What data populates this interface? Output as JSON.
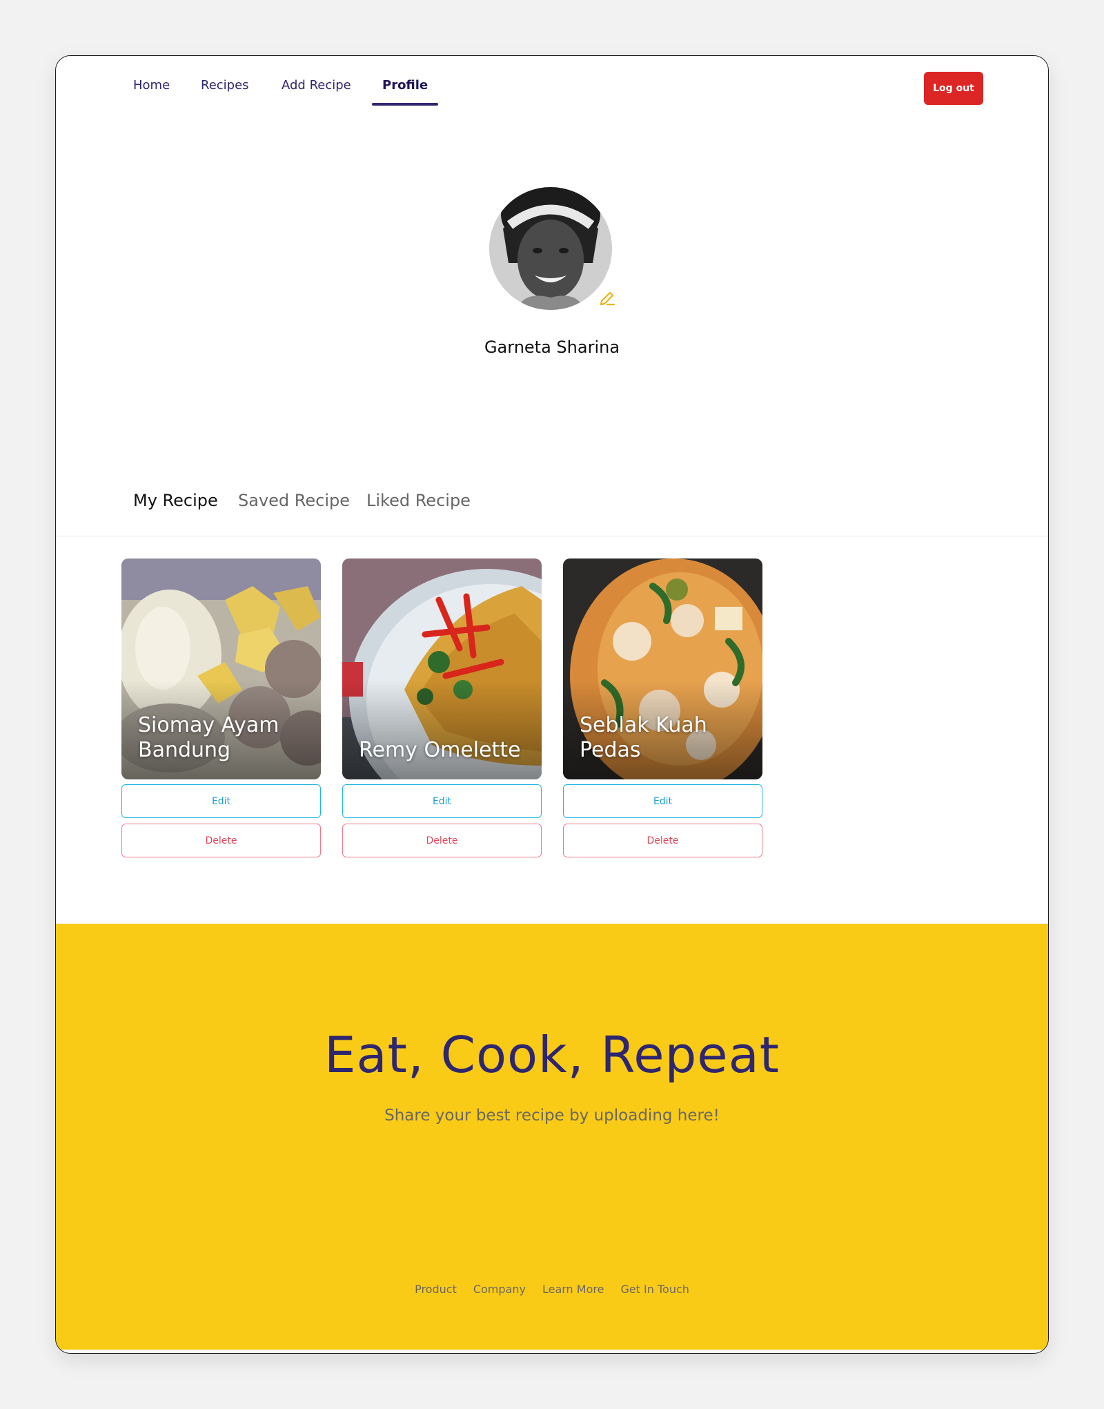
{
  "nav": {
    "items": [
      {
        "label": "Home"
      },
      {
        "label": "Recipes"
      },
      {
        "label": "Add Recipe"
      },
      {
        "label": "Profile",
        "active": true
      }
    ],
    "logout_label": "Log out"
  },
  "profile": {
    "name": "Garneta Sharina",
    "avatar_alt": "edit-avatar-icon"
  },
  "tabs": [
    {
      "label": "My Recipe",
      "active": true
    },
    {
      "label": "Saved Recipe"
    },
    {
      "label": "Liked Recipe"
    }
  ],
  "recipes": [
    {
      "title": "Siomay Ayam Bandung",
      "edit_label": "Edit",
      "delete_label": "Delete"
    },
    {
      "title": "Remy Omelette",
      "edit_label": "Edit",
      "delete_label": "Delete"
    },
    {
      "title": "Seblak Kuah Pedas",
      "edit_label": "Edit",
      "delete_label": "Delete"
    }
  ],
  "footer": {
    "title": "Eat, Cook, Repeat",
    "subtitle": "Share your best recipe by uploading here!",
    "links": [
      "Product",
      "Company",
      "Learn More",
      "Get In Touch"
    ]
  },
  "colors": {
    "primary": "#2e266f",
    "logout": "#dc2626",
    "footer_bg": "#f9cb17",
    "edit": "#1fb6e6",
    "delete": "#f07a8a"
  }
}
